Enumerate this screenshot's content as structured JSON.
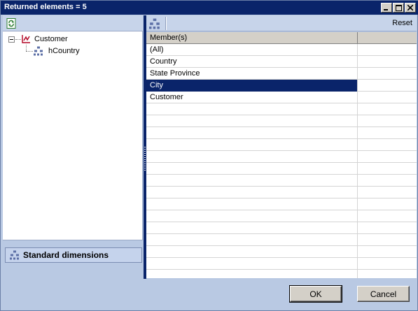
{
  "window": {
    "title": "Returned elements = 5"
  },
  "left_pane": {
    "tree": [
      {
        "label": "Customer",
        "icon": "dimension-icon",
        "expanded": true
      },
      {
        "label": "hCountry",
        "icon": "hierarchy-icon"
      }
    ],
    "dimension_group": {
      "label": "Standard dimensions",
      "icon": "hierarchy-icon"
    }
  },
  "right_pane": {
    "toolbar": {
      "reset_label": "Reset"
    },
    "grid": {
      "columns": [
        "Member(s)",
        ""
      ],
      "rows": [
        "(All)",
        "Country",
        "State Province",
        "City",
        "Customer"
      ],
      "selected_row": "City",
      "total_visible_rows": 20
    }
  },
  "buttons": {
    "ok_label": "OK",
    "cancel_label": "Cancel"
  },
  "colors": {
    "selection": "#0a246a",
    "panel_bg": "#b9c9e3",
    "title_bar": "#0a246a"
  }
}
